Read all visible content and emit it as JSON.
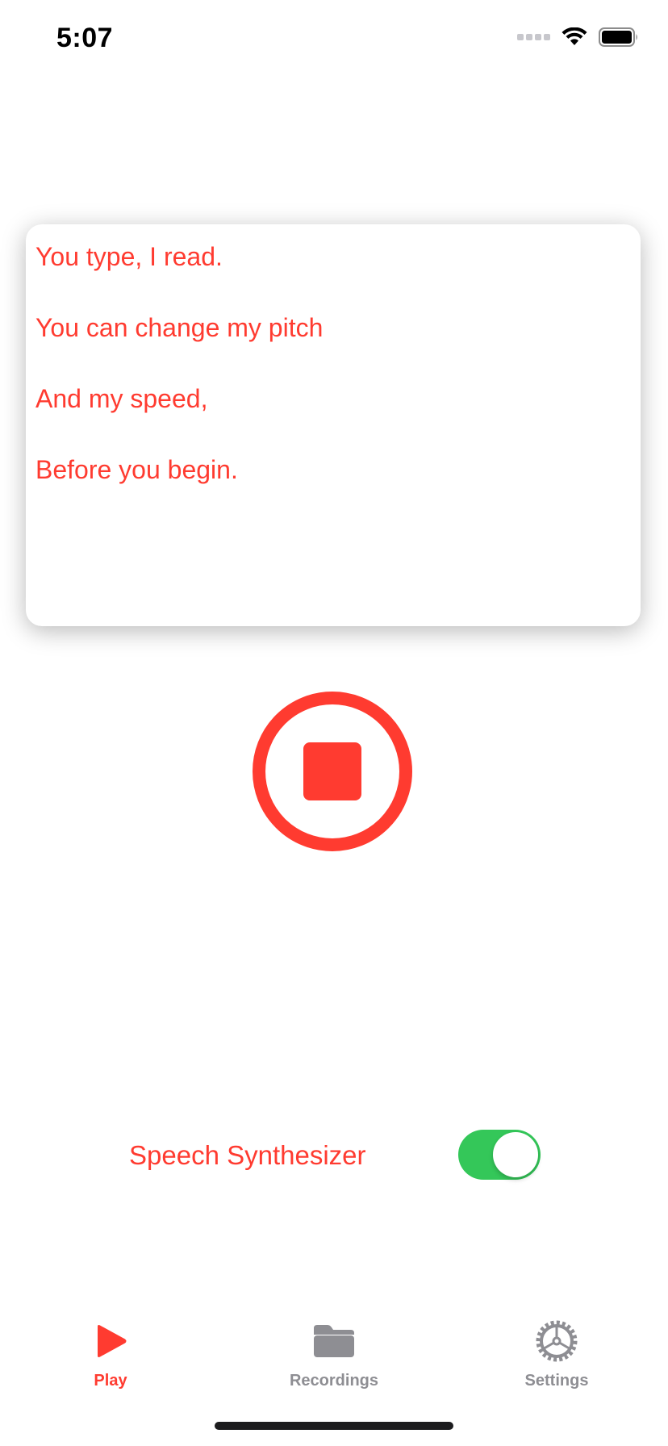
{
  "status_bar": {
    "time": "5:07",
    "icons": [
      "cellular-signal-icon",
      "wifi-icon",
      "battery-icon"
    ]
  },
  "text_view": {
    "lines": [
      "You type, I read.",
      "You can change my pitch",
      "And my speed,",
      "Before you begin."
    ]
  },
  "controls": {
    "stop_icon": "stop-icon",
    "speech_synthesizer_label": "Speech Synthesizer",
    "speech_synthesizer_on": true
  },
  "tab_bar": {
    "tabs": [
      {
        "label": "Play",
        "icon": "play-icon",
        "active": true
      },
      {
        "label": "Recordings",
        "icon": "folder-icon",
        "active": false
      },
      {
        "label": "Settings",
        "icon": "gear-icon",
        "active": false
      }
    ]
  },
  "colors": {
    "accent": "#ff3b30",
    "toggle_on": "#34c759",
    "inactive": "#8e8e93"
  }
}
